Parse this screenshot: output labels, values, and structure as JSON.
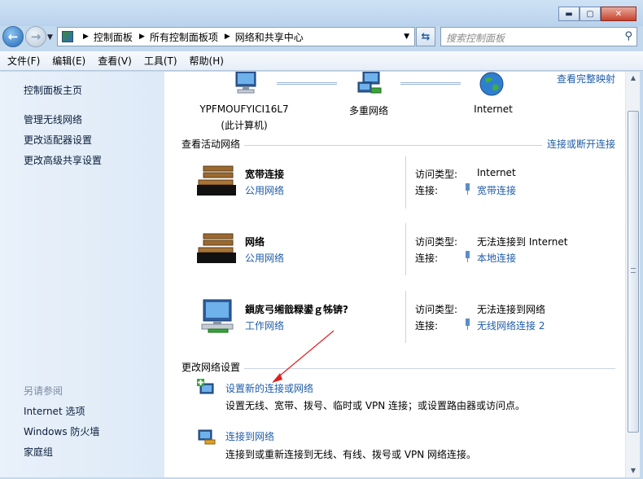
{
  "window": {
    "minimize": "▬",
    "maximize": "▢",
    "close": "✕"
  },
  "address": {
    "crumbs": [
      "控制面板",
      "所有控制面板项",
      "网络和共享中心"
    ],
    "search_placeholder": "搜索控制面板"
  },
  "menu": [
    "文件(F)",
    "编辑(E)",
    "查看(V)",
    "工具(T)",
    "帮助(H)"
  ],
  "sidebar": {
    "links": [
      "控制面板主页",
      "管理无线网络",
      "更改适配器设置",
      "更改高级共享设置"
    ],
    "see_also_title": "另请参阅",
    "see_also": [
      "Internet 选项",
      "Windows 防火墙",
      "家庭组"
    ]
  },
  "map": {
    "view_full_map": "查看完整映射",
    "computer_name": "YPFMOUFYICI16L7",
    "computer_sub": "(此计算机)",
    "multi_network": "多重网络",
    "internet": "Internet"
  },
  "active": {
    "title": "查看活动网络",
    "connect_link": "连接或断开连接",
    "access_label": "访问类型:",
    "connection_label": "连接:",
    "networks": [
      {
        "name": "宽带连接",
        "type": "公用网络",
        "access": "Internet",
        "connection": "宽带连接",
        "icon": "park-bench-icon"
      },
      {
        "name": "网络",
        "type": "公用网络",
        "access": "无法连接到 Internet",
        "connection": "本地连接",
        "icon": "park-bench-icon"
      },
      {
        "name": "鎻庣弓缃戠粶鍙ｇ牬锛?",
        "type": "工作网络",
        "access": "无法连接到网络",
        "connection": "无线网络连接 2",
        "icon": "work-network-icon"
      }
    ]
  },
  "change": {
    "title": "更改网络设置",
    "tasks": [
      {
        "link": "设置新的连接或网络",
        "desc": "设置无线、宽带、拨号、临时或 VPN 连接；或设置路由器或访问点。"
      },
      {
        "link": "连接到网络",
        "desc": "连接到或重新连接到无线、有线、拨号或 VPN 网络连接。"
      }
    ]
  },
  "colors": {
    "link": "#1f5ca8",
    "arrow": "#e02020"
  }
}
